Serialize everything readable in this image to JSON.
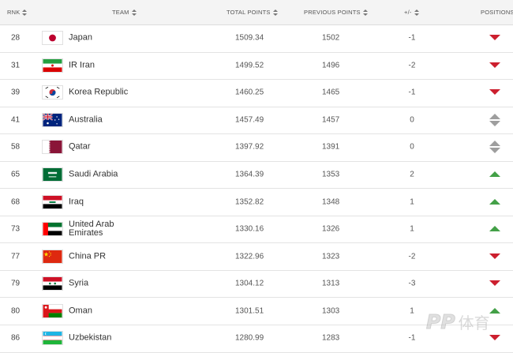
{
  "header": {
    "rank": "RNK",
    "team": "TEAM",
    "total_points": "TOTAL POINTS",
    "previous_points": "PREVIOUS POINTS",
    "plus_minus": "+/-",
    "positions": "POSITIONS"
  },
  "rows": [
    {
      "rank": "28",
      "team": "Japan",
      "flag": "japan-flag-icon",
      "total": "1509.34",
      "previous": "1502",
      "pm": "-1",
      "trend": "down"
    },
    {
      "rank": "31",
      "team": "IR Iran",
      "flag": "iran-flag-icon",
      "total": "1499.52",
      "previous": "1496",
      "pm": "-2",
      "trend": "down"
    },
    {
      "rank": "39",
      "team": "Korea Republic",
      "flag": "korea-flag-icon",
      "total": "1460.25",
      "previous": "1465",
      "pm": "-1",
      "trend": "down"
    },
    {
      "rank": "41",
      "team": "Australia",
      "flag": "australia-flag-icon",
      "total": "1457.49",
      "previous": "1457",
      "pm": "0",
      "trend": "same"
    },
    {
      "rank": "58",
      "team": "Qatar",
      "flag": "qatar-flag-icon",
      "total": "1397.92",
      "previous": "1391",
      "pm": "0",
      "trend": "same"
    },
    {
      "rank": "65",
      "team": "Saudi Arabia",
      "flag": "saudi-arabia-flag-icon",
      "total": "1364.39",
      "previous": "1353",
      "pm": "2",
      "trend": "up"
    },
    {
      "rank": "68",
      "team": "Iraq",
      "flag": "iraq-flag-icon",
      "total": "1352.82",
      "previous": "1348",
      "pm": "1",
      "trend": "up"
    },
    {
      "rank": "73",
      "team": "United Arab Emirates",
      "team_line1": "United Arab",
      "team_line2": "Emirates",
      "flag": "uae-flag-icon",
      "total": "1330.16",
      "previous": "1326",
      "pm": "1",
      "trend": "up"
    },
    {
      "rank": "77",
      "team": "China PR",
      "flag": "china-flag-icon",
      "total": "1322.96",
      "previous": "1323",
      "pm": "-2",
      "trend": "down"
    },
    {
      "rank": "79",
      "team": "Syria",
      "flag": "syria-flag-icon",
      "total": "1304.12",
      "previous": "1313",
      "pm": "-3",
      "trend": "down"
    },
    {
      "rank": "80",
      "team": "Oman",
      "flag": "oman-flag-icon",
      "total": "1301.51",
      "previous": "1303",
      "pm": "1",
      "trend": "up"
    },
    {
      "rank": "86",
      "team": "Uzbekistan",
      "flag": "uzbekistan-flag-icon",
      "total": "1280.99",
      "previous": "1283",
      "pm": "-1",
      "trend": "down"
    }
  ],
  "colors": {
    "down": "#cc1f2e",
    "up": "#43a047",
    "same": "#9e9e9e"
  },
  "watermark": {
    "latin": "PP",
    "cn": "体育"
  }
}
